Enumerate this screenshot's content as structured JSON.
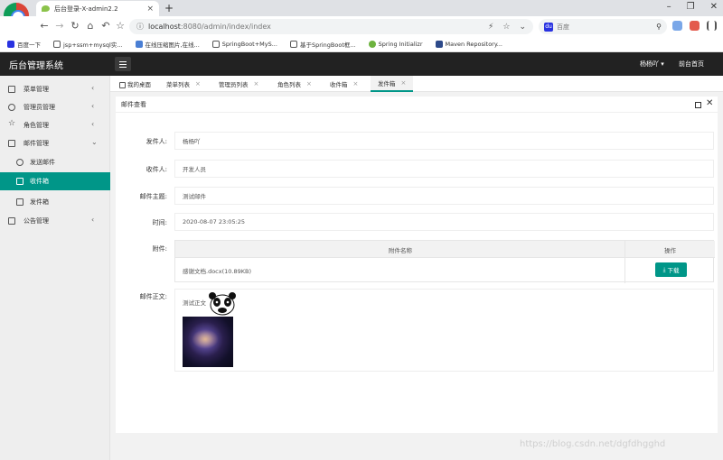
{
  "browser": {
    "tab_title": "后台登录-X-admin2.2",
    "url_host": "localhost",
    "url_rest": ":8080/admin/index/index",
    "search_placeholder": "百度",
    "bookmarks": [
      "百度一下",
      "jsp+ssm+mysql实...",
      "在线压缩图片,在线...",
      "SpringBoot+MyS...",
      "基于SpringBoot框...",
      "Spring Initializr",
      "Maven Repository..."
    ]
  },
  "header": {
    "logo": "后台管理系统",
    "user": "杨杨吖",
    "front_link": "前台首页"
  },
  "sidebar": {
    "items": [
      {
        "label": "菜单管理",
        "arrow": "‹"
      },
      {
        "label": "管理员管理",
        "arrow": "‹"
      },
      {
        "label": "角色管理",
        "arrow": "‹"
      },
      {
        "label": "邮件管理",
        "arrow": "⌄"
      },
      {
        "label": "发送邮件"
      },
      {
        "label": "收件箱"
      },
      {
        "label": "发件箱"
      },
      {
        "label": "公告管理",
        "arrow": "‹"
      }
    ]
  },
  "tabs": [
    {
      "label": "我的桌面"
    },
    {
      "label": "菜单列表",
      "close": "×"
    },
    {
      "label": "管理员列表",
      "close": "×"
    },
    {
      "label": "角色列表",
      "close": "×"
    },
    {
      "label": "收件箱",
      "close": "×"
    },
    {
      "label": "发件箱",
      "close": "×"
    }
  ],
  "card": {
    "title": "邮件查看"
  },
  "form": {
    "sender_label": "发件人:",
    "sender": "杨杨吖",
    "recipient_label": "收件人:",
    "recipient": "开发人员",
    "subject_label": "邮件主题:",
    "subject": "测试邮件",
    "time_label": "时间:",
    "time": "2020-08-07 23:05:25",
    "attachment_label": "附件:",
    "attachment_col_name": "附件名称",
    "attachment_col_action": "操作",
    "attachment_file": "感谢文档.docx(10.89KB)",
    "download": "下载",
    "body_label": "邮件正文:",
    "body_text": "测试正文"
  },
  "watermark": "https://blog.csdn.net/dgfdhgghd",
  "colors": {
    "accent": "#009688",
    "header_bg": "#222222",
    "sidebar_bg": "#eeeeee"
  }
}
